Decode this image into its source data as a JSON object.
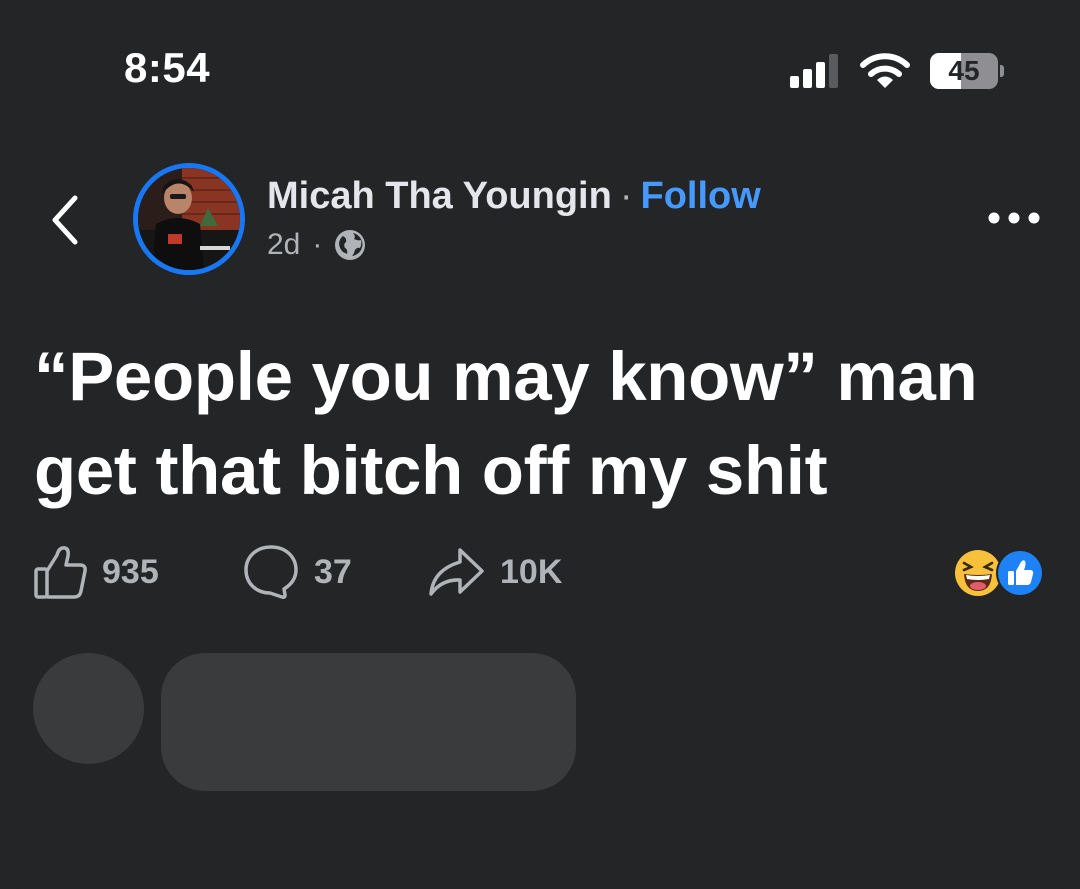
{
  "status_bar": {
    "time": "8:54",
    "battery_percent": "45",
    "battery_level": 0.45,
    "icons": [
      "signal-icon",
      "wifi-icon",
      "battery-icon"
    ]
  },
  "header": {
    "back_icon": "chevron-left-icon",
    "author_name": "Micah Tha Youngin",
    "separator": "·",
    "follow_label": "Follow",
    "timestamp": "2d",
    "meta_separator": "·",
    "audience_icon": "globe-icon",
    "more_icon": "more-horizontal-icon"
  },
  "post": {
    "text": "“People you may know” man get that bitch off my shit"
  },
  "actions": {
    "like_count": "935",
    "comment_count": "37",
    "share_count": "10K",
    "reactions": [
      "haha-reaction-icon",
      "like-reaction-icon"
    ]
  },
  "colors": {
    "background": "#232526",
    "accent": "#1877f2",
    "link": "#4599ff",
    "secondary_text": "#b0b3b8",
    "placeholder": "#3a3b3c"
  }
}
